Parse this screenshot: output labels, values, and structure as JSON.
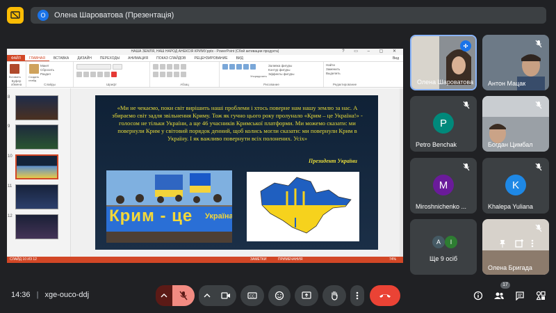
{
  "header": {
    "presenter_initial": "О",
    "title": "Олена Шароватова (Презентація)"
  },
  "ppt": {
    "window_title": "НАША ЗЕМЛЯ, НАШ НАРОД АНЕКСІЯ КРИМУ.pptx - PowerPoint (Сбой активации продукта)",
    "tabs": [
      "ФАЙЛ",
      "ГЛАВНАЯ",
      "ВСТАВКА",
      "ДИЗАЙН",
      "ПЕРЕХОДЫ",
      "АНИМАЦИЯ",
      "ПОКАЗ СЛАЙДОВ",
      "РЕЦЕНЗИРОВАНИЕ",
      "ВИД"
    ],
    "user": "Вид",
    "ribbon_groups": [
      "Буфер обмена",
      "Слайды",
      "Шрифт",
      "Абзац",
      "Рисование",
      "Редактирование"
    ],
    "ribbon_items": {
      "paste": "Вставить",
      "create_slide": "Создать слайд",
      "layout": "Макет",
      "reset": "Сбросить",
      "section": "Раздел",
      "arrange": "Упорядочить",
      "quick_styles": "Экспресс-стили",
      "fill": "Заливка фигуры",
      "outline": "Контур фигуры",
      "effects": "Эффекты фигуры",
      "find": "Найти",
      "replace": "Заменить",
      "select": "Выделить"
    },
    "thumb_numbers": [
      "8",
      "9",
      "10",
      "11",
      "12"
    ],
    "status_left": "СЛАЙД 10 ИЗ 12",
    "status_notes": "ЗАМЕТКИ",
    "status_comments": "ПРИМЕЧАНИЯ",
    "zoom": "74%"
  },
  "slide": {
    "quote": "«Ми не чекаємо, поки світ вирішить наші проблеми і хтось поверне нам нашу землю за нас. А збираємо світ задля звільнення Криму. Тож як гучно цього року пролунало «Крим – це Україна!» - голосом не тільки України, а ще 46 учасників Кримської платформи. Ми можемо сказати: ми повернули Крим у світовий порядок денний, щоб колись могли сказати: ми повернули Крим в Україну. І як важливо повернути всіх полонених. Усіх»",
    "signature": "Президент України",
    "banner_text": "Крим - це",
    "banner_text2": "Україна"
  },
  "participants": [
    {
      "name": "Олена Шароватова",
      "type": "video",
      "speaking": true
    },
    {
      "name": "Антон Мацак",
      "type": "video",
      "muted": true
    },
    {
      "name": "Petro Benchak",
      "initial": "P",
      "color": "#00897b",
      "muted": true
    },
    {
      "name": "Богдан Цимбал",
      "type": "video",
      "muted": true
    },
    {
      "name": "Miroshnichenko ...",
      "initial": "M",
      "color": "#6a1b9a",
      "muted": true
    },
    {
      "name": "Khalepa Yuliana",
      "initial": "K",
      "color": "#1e88e5",
      "muted": true
    },
    {
      "name": "Ще 9 осіб",
      "initials": [
        "A",
        "I"
      ],
      "colors": [
        "#455a64",
        "#2e7d32"
      ]
    },
    {
      "name": "Олена Бригада",
      "type": "video",
      "muted": true
    }
  ],
  "bottom": {
    "time": "14:36",
    "meeting_code": "xge-ouco-ddj",
    "participant_count": "17"
  }
}
